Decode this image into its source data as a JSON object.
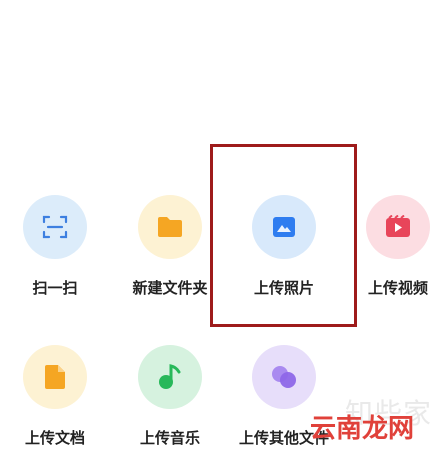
{
  "grid": {
    "items": [
      {
        "label": "扫一扫",
        "icon": "scan-icon",
        "bg": "#dcecfa"
      },
      {
        "label": "新建文件夹",
        "icon": "folder-icon",
        "bg": "#fdf2d3"
      },
      {
        "label": "上传照片",
        "icon": "image-icon",
        "bg": "#d8e9fb"
      },
      {
        "label": "上传视频",
        "icon": "video-icon",
        "bg": "#fcdde2"
      },
      {
        "label": "上传文档",
        "icon": "document-icon",
        "bg": "#fdf2d3"
      },
      {
        "label": "上传音乐",
        "icon": "music-icon",
        "bg": "#d6f2df"
      },
      {
        "label": "上传其他文件",
        "icon": "other-files-icon",
        "bg": "#e7defa"
      }
    ]
  },
  "watermark": {
    "top_text": "知些家",
    "main_text": "云南龙网"
  },
  "colors": {
    "highlight_border": "#9e1b1b",
    "scan_blue": "#3d7fe0",
    "folder_orange": "#f5a623",
    "image_blue": "#2f7df0",
    "video_red": "#e8455a",
    "music_green": "#28b85a",
    "other_purple": "#8e67e8",
    "watermark_red": "#e0413a"
  }
}
